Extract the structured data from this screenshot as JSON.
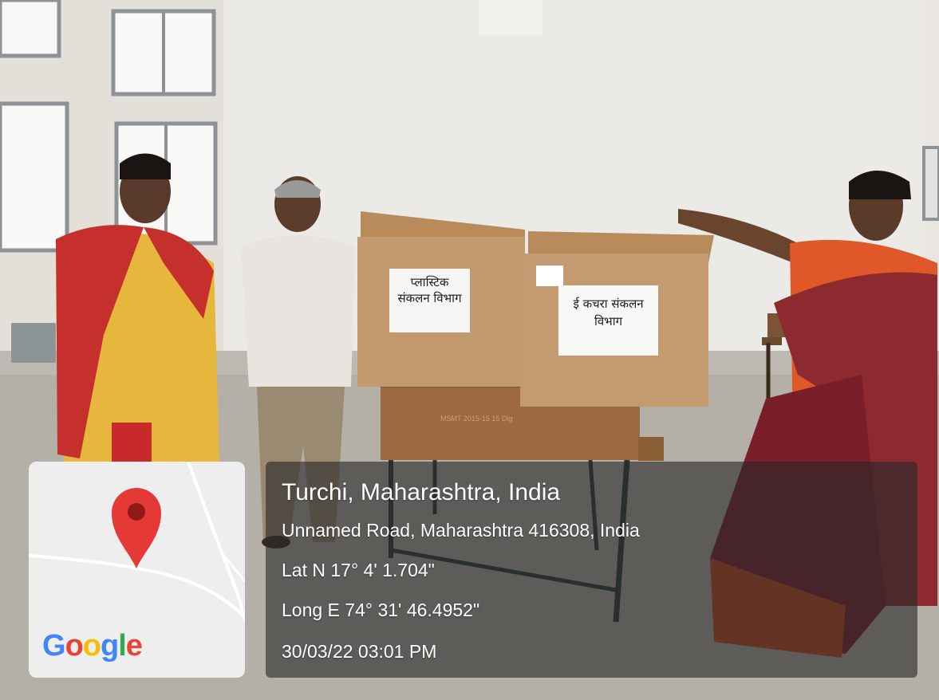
{
  "photo": {
    "box_left_label": "प्लास्टिक संकलन विभाग",
    "box_right_label": "ई कचरा संकलन विभाग",
    "desk_marking": "MSMT 2015-15 15 Dig"
  },
  "map_card": {
    "logo_text": "Google",
    "logo_letters": [
      {
        "ch": "G",
        "color": "#4285F4"
      },
      {
        "ch": "o",
        "color": "#EA4335"
      },
      {
        "ch": "o",
        "color": "#FBBC05"
      },
      {
        "ch": "g",
        "color": "#4285F4"
      },
      {
        "ch": "l",
        "color": "#34A853"
      },
      {
        "ch": "e",
        "color": "#EA4335"
      }
    ],
    "pin_icon": "map-pin-icon",
    "pin_color": "#E53935"
  },
  "info": {
    "place": "Turchi, Maharashtra, India",
    "address": "Unnamed Road, Maharashtra 416308, India",
    "latitude": "Lat N 17° 4' 1.704\"",
    "longitude": "Long E 74° 31' 46.4952\"",
    "timestamp": "30/03/22 03:01 PM"
  }
}
